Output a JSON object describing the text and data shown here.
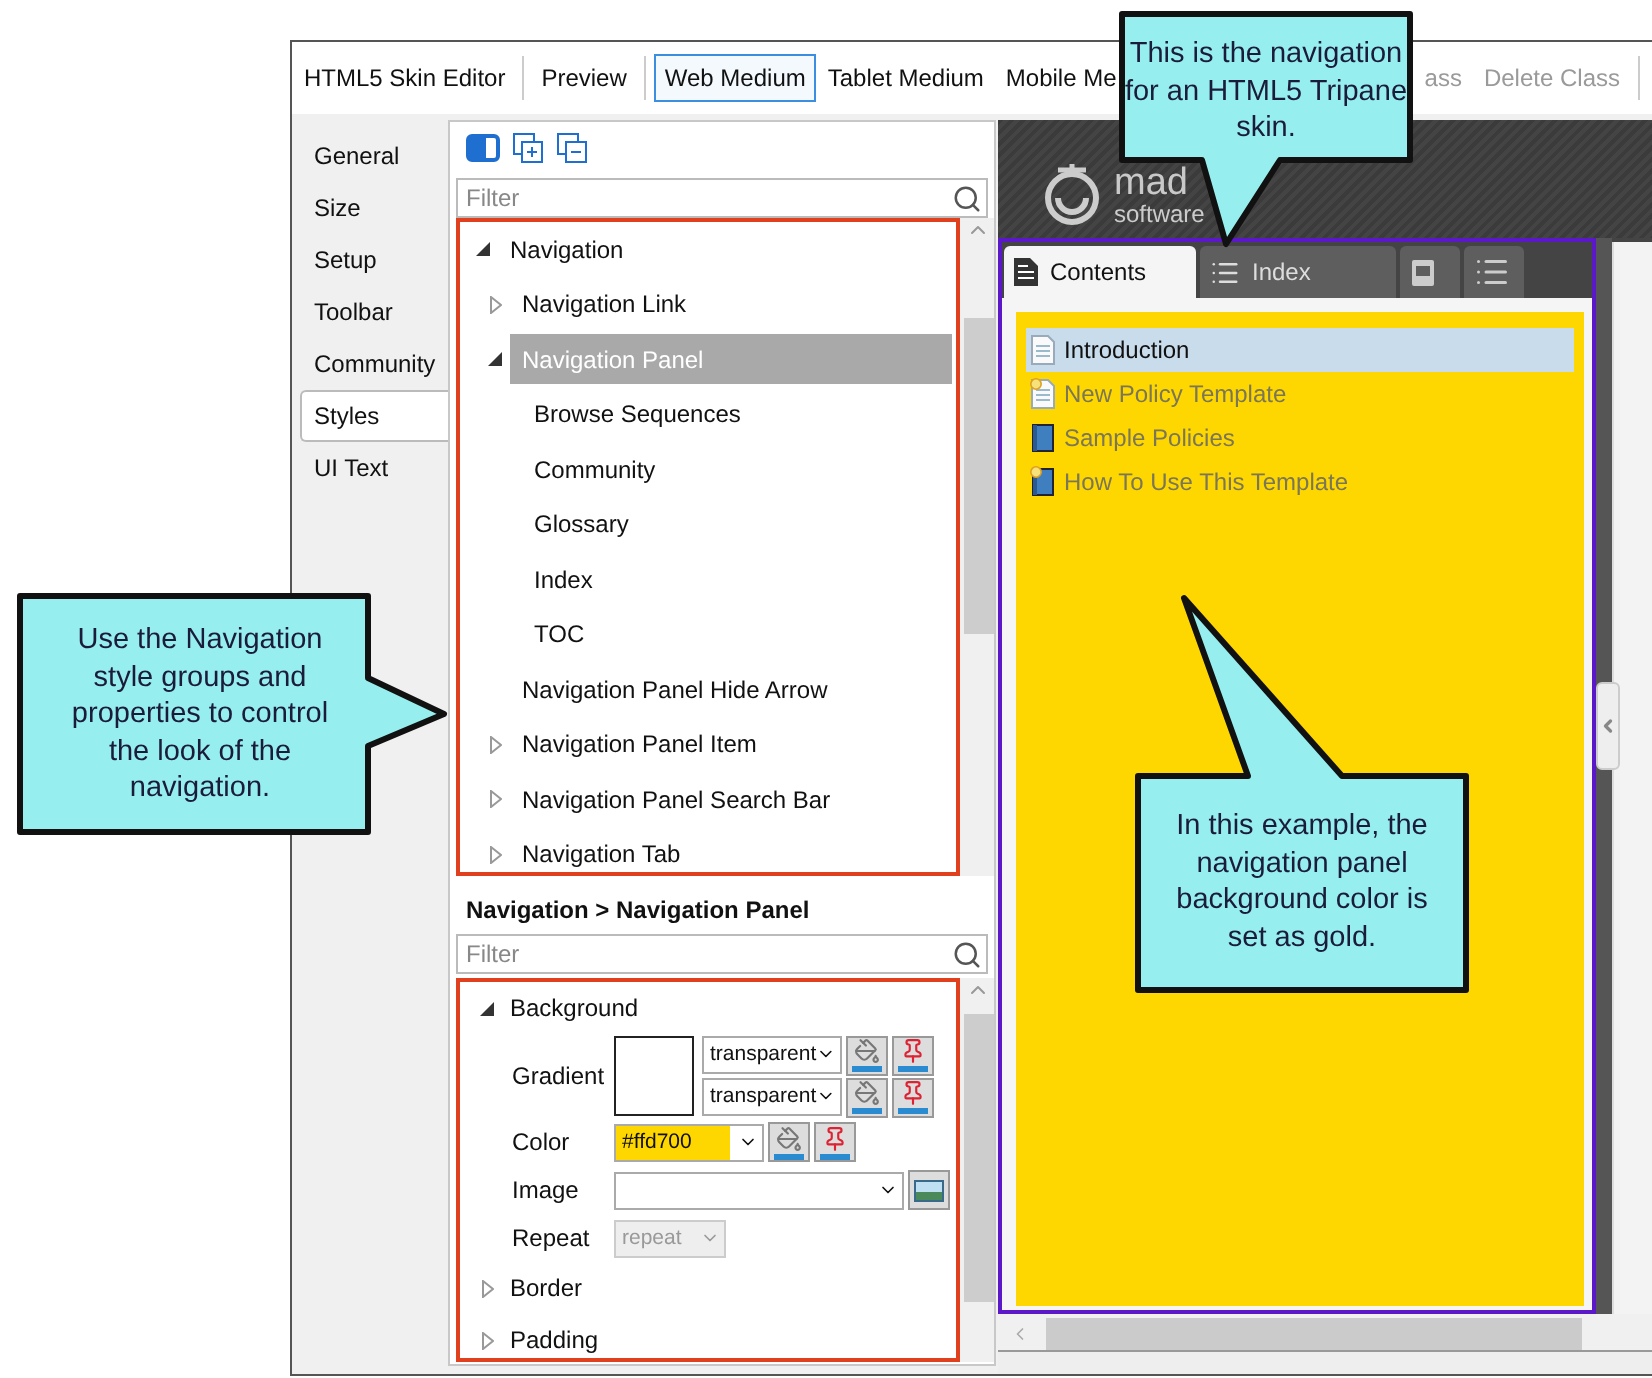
{
  "toolbar": {
    "left": [
      {
        "label": "HTML5 Skin Editor",
        "kind": "title"
      },
      {
        "kind": "separator"
      },
      {
        "label": "Preview",
        "kind": "button",
        "selected": false,
        "disabled": false
      },
      {
        "kind": "separator"
      },
      {
        "label": "Web Medium",
        "kind": "button",
        "selected": true,
        "disabled": false
      },
      {
        "label": "Tablet Medium",
        "kind": "button",
        "selected": false,
        "disabled": false
      },
      {
        "label": "Mobile Me",
        "kind": "button",
        "selected": false,
        "disabled": false
      }
    ],
    "right": [
      {
        "label": "ass",
        "kind": "button",
        "selected": false,
        "disabled": true
      },
      {
        "label": "Delete Class",
        "kind": "button",
        "selected": false,
        "disabled": true
      },
      {
        "kind": "separator"
      }
    ]
  },
  "side_tabs": [
    {
      "label": "General",
      "selected": false
    },
    {
      "label": "Size",
      "selected": false
    },
    {
      "label": "Setup",
      "selected": false
    },
    {
      "label": "Toolbar",
      "selected": false
    },
    {
      "label": "Community",
      "selected": false
    },
    {
      "label": "Styles",
      "selected": true
    },
    {
      "label": "UI Text",
      "selected": false
    }
  ],
  "styles": {
    "filter_placeholder": "Filter",
    "tree": [
      {
        "label": "Navigation",
        "kind": "group",
        "expanded": true,
        "selected": false,
        "children": [
          {
            "label": "Navigation Link",
            "kind": "group",
            "expanded": false,
            "selected": false
          },
          {
            "label": "Navigation Panel",
            "kind": "group",
            "expanded": true,
            "selected": true,
            "children": [
              {
                "label": "Browse Sequences",
                "kind": "leaf",
                "selected": false
              },
              {
                "label": "Community",
                "kind": "leaf",
                "selected": false
              },
              {
                "label": "Glossary",
                "kind": "leaf",
                "selected": false
              },
              {
                "label": "Index",
                "kind": "leaf",
                "selected": false
              },
              {
                "label": "TOC",
                "kind": "leaf",
                "selected": false
              }
            ]
          },
          {
            "label": "Navigation Panel Hide Arrow",
            "kind": "leaf",
            "selected": false
          },
          {
            "label": "Navigation Panel Item",
            "kind": "group",
            "expanded": false,
            "selected": false
          },
          {
            "label": "Navigation Panel Search Bar",
            "kind": "group",
            "expanded": false,
            "selected": false
          },
          {
            "label": "Navigation Tab",
            "kind": "group",
            "expanded": false,
            "selected": false
          }
        ]
      }
    ]
  },
  "properties": {
    "breadcrumb": "Navigation > Navigation Panel",
    "filter_placeholder": "Filter",
    "groups": [
      {
        "label": "Background",
        "expanded": true,
        "rows": [
          {
            "kind": "gradient",
            "label": "Gradient",
            "stops": [
              "transparent",
              "transparent"
            ]
          },
          {
            "kind": "color",
            "label": "Color",
            "value": "#ffd700",
            "color": "#ffd700"
          },
          {
            "kind": "image",
            "label": "Image"
          },
          {
            "kind": "select",
            "label": "Repeat",
            "value": "repeat",
            "disabled": true
          }
        ]
      },
      {
        "label": "Border",
        "expanded": false
      },
      {
        "label": "Padding",
        "expanded": false
      }
    ]
  },
  "preview": {
    "logo": {
      "wordmark": "mad",
      "tagline": "software"
    },
    "nav_tabs": [
      {
        "label": "Contents",
        "selected": true
      },
      {
        "label": "Index",
        "selected": false
      },
      {
        "selected": false
      },
      {
        "selected": false
      }
    ],
    "toc": [
      {
        "label": "Introduction",
        "kind": "page",
        "new": false,
        "selected": true
      },
      {
        "label": "New Policy Template",
        "kind": "page",
        "new": true,
        "selected": false
      },
      {
        "label": "Sample Policies",
        "kind": "book",
        "new": false,
        "selected": false
      },
      {
        "label": "How To Use This Template",
        "kind": "book",
        "new": true,
        "selected": false
      }
    ]
  },
  "callouts": [
    {
      "text": "This is the navigation for an HTML5 Tripane skin."
    },
    {
      "text": "Use the Navigation style groups and properties to control the look of the navigation."
    },
    {
      "text": "In this example, the navigation panel background color is set as gold."
    }
  ]
}
